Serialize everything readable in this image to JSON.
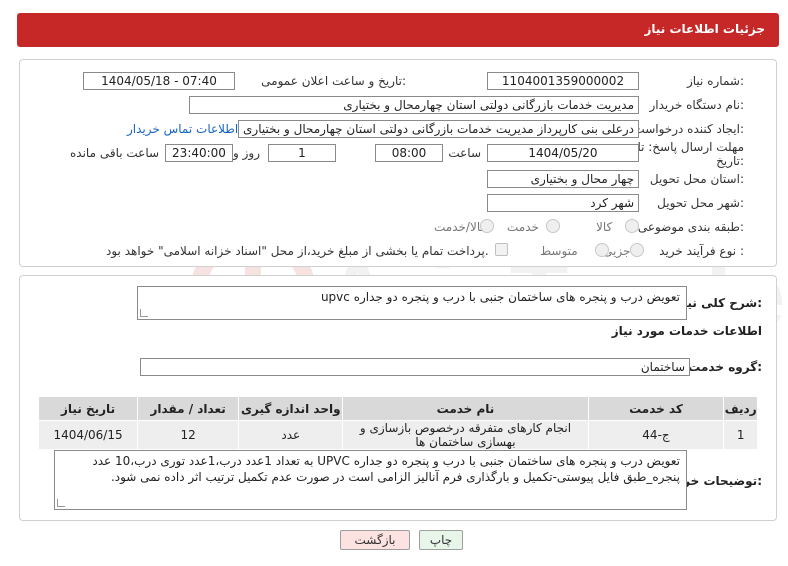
{
  "header": {
    "title": "جزئیات اطلاعات نیاز"
  },
  "form": {
    "need_number_label": "شماره نیاز:",
    "need_number": "1104001359000002",
    "announce_label": "تاریخ و ساعت اعلان عمومی:",
    "announce_value": "1404/05/18 - 07:40",
    "buyer_org_label": "نام دستگاه خریدار:",
    "buyer_org": "مدیریت خدمات بازرگانی دولتی استان چهارمحال و بختیاری",
    "creator_label": "ایجاد کننده درخواست:",
    "creator": "محمد درعلی بنی کارپرداز مدیریت خدمات بازرگانی دولتی استان چهارمحال و بختیاری",
    "contact_link": "اطلاعات تماس خریدار",
    "deadline_label_1": "مهلت ارسال پاسخ: تا",
    "deadline_label_2": "تاریخ:",
    "deadline_date": "1404/05/20",
    "time_label": "ساعت",
    "deadline_time": "08:00",
    "days_value": "1",
    "days_label": "روز و",
    "remaining_time": "23:40:00",
    "remaining_label": "ساعت باقی مانده",
    "province_label": "استان محل تحویل:",
    "province": "چهار محال و بختیاری",
    "city_label": "شهر محل تحویل:",
    "city": "شهر کرد",
    "category_label": "طبقه بندی موضوعی:",
    "category_options": [
      "کالا",
      "خدمت",
      "کالا/خدمت"
    ],
    "process_label": "نوع فرآیند خرید :",
    "process_options": [
      "جزیی",
      "متوسط"
    ],
    "payment_note": "پرداخت تمام یا بخشی از مبلغ خرید،از محل \"اسناد خزانه اسلامی\" خواهد بود."
  },
  "details": {
    "summary_label": "شرح کلی نیاز:",
    "summary": "تعویض درب و پنجره های ساختمان جنبی با درب و پنجره دو جداره upvc",
    "services_heading": "اطلاعات خدمات مورد نیاز",
    "service_group_label": "گروه خدمت:",
    "service_group": "ساختمان",
    "table": {
      "headers": [
        "ردیف",
        "کد خدمت",
        "نام خدمت",
        "واحد اندازه گیری",
        "تعداد / مقدار",
        "تاریخ نیاز"
      ],
      "rows": [
        [
          "1",
          "ج-44",
          "انجام کارهای متفرقه درخصوص بازسازی و بهسازی ساختمان ها",
          "عدد",
          "12",
          "1404/06/15"
        ]
      ]
    },
    "buyer_notes_label": "توضیحات خریدار:",
    "buyer_notes": "تعویض درب و پنجره های ساختمان جنبی با درب و پنجره دو جداره UPVC به تعداد 1عدد درب،1عدد توری درب،10 عدد پنجره_طبق فایل پیوستی-تکمیل و بارگذاری فرم آنالیز الزامی است در صورت عدم تکمیل ترتیب اثر داده نمی شود."
  },
  "buttons": {
    "print": "چاپ",
    "back": "بازگشت"
  },
  "colors": {
    "header": "#c62828",
    "link": "#1565c0"
  }
}
